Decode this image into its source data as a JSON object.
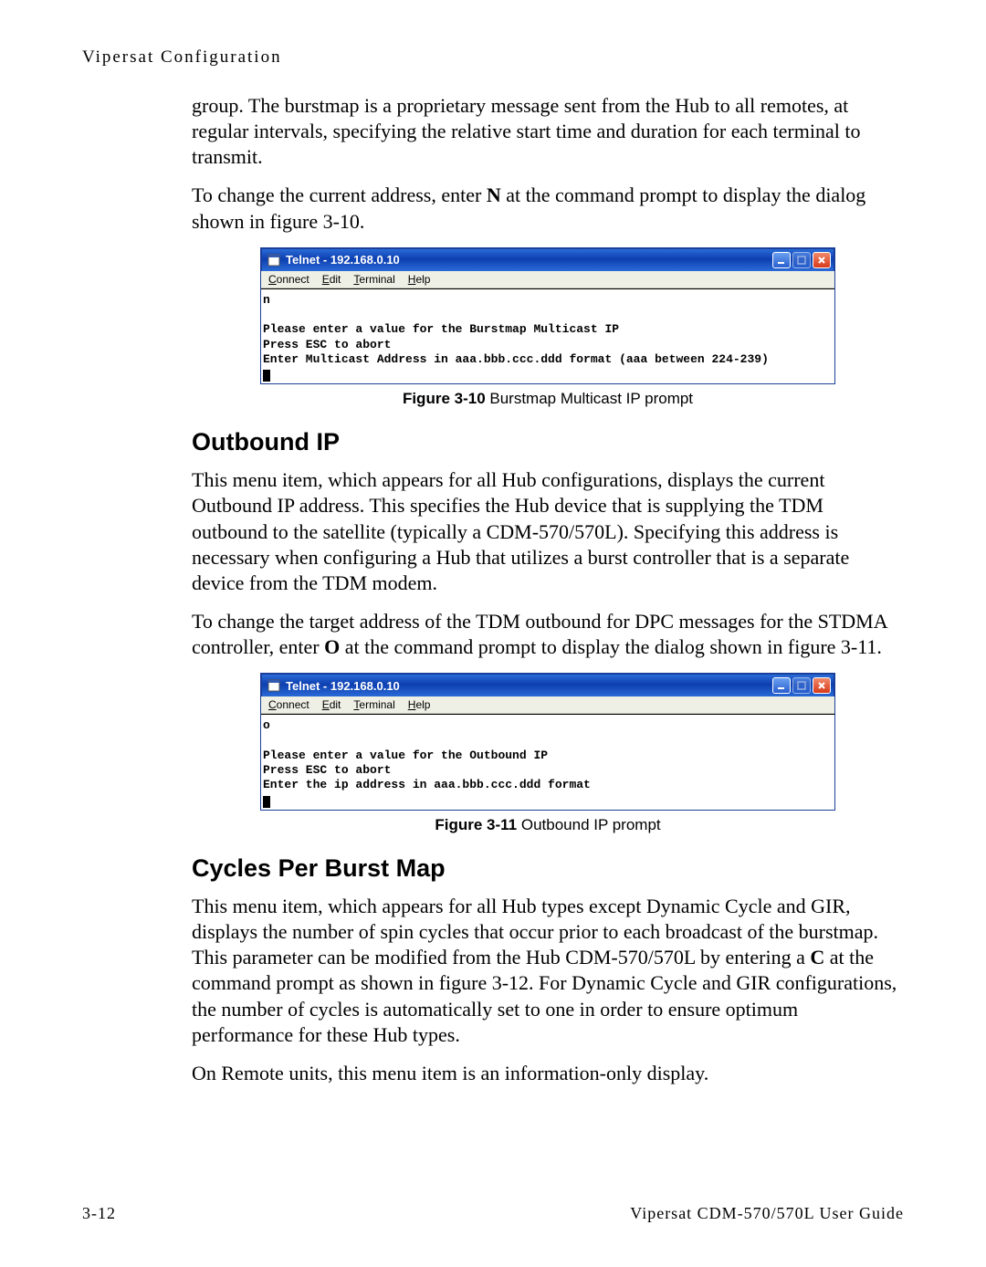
{
  "running_head": "Vipersat Configuration",
  "intro": {
    "p1": "group. The burstmap is a proprietary message sent from the Hub to all remotes, at regular intervals, specifying the relative start time and duration for each terminal to transmit.",
    "p2_a": "To change the current address, enter ",
    "p2_b": "N",
    "p2_c": " at the command prompt to display the dialog shown in figure 3-10."
  },
  "telnet1": {
    "title": "Telnet - 192.168.0.10",
    "menu": {
      "connect_u": "C",
      "connect": "onnect",
      "edit_u": "E",
      "edit": "dit",
      "terminal_u": "T",
      "terminal": "erminal",
      "help_u": "H",
      "help": "elp"
    },
    "lines": {
      "cmd": "n",
      "blank": "",
      "l1": "Please enter a value for the Burstmap Multicast IP",
      "l2": "Press ESC to abort",
      "l3": "Enter Multicast Address in aaa.bbb.ccc.ddd format (aaa between 224-239)"
    }
  },
  "fig1": {
    "label": "Figure 3-10",
    "text": "  Burstmap Multicast IP prompt"
  },
  "outbound": {
    "heading": "Outbound IP",
    "p1": "This menu item, which appears for all Hub configurations, displays the current Outbound IP address. This specifies the Hub device that is supplying the TDM outbound to the satellite (typically a CDM-570/570L). Specifying this address is necessary when configuring a Hub that utilizes a burst controller that is a separate device from the TDM modem.",
    "p2_a": "To change the target address of the TDM outbound for DPC messages for the STDMA controller, enter ",
    "p2_b": "O",
    "p2_c": " at the command prompt to display the dialog shown in figure 3-11."
  },
  "telnet2": {
    "title": "Telnet - 192.168.0.10",
    "menu": {
      "connect_u": "C",
      "connect": "onnect",
      "edit_u": "E",
      "edit": "dit",
      "terminal_u": "T",
      "terminal": "erminal",
      "help_u": "H",
      "help": "elp"
    },
    "lines": {
      "cmd": "o",
      "blank": "",
      "l1": "Please enter a value for the Outbound IP",
      "l2": "Press ESC to abort",
      "l3": "Enter the ip address in aaa.bbb.ccc.ddd format"
    }
  },
  "fig2": {
    "label": "Figure 3-11",
    "text": "  Outbound IP prompt"
  },
  "cycles": {
    "heading": "Cycles Per Burst Map",
    "p1_a": "This menu item, which appears for all Hub types except Dynamic Cycle and GIR, displays the number of spin cycles that occur prior to each broadcast of the burstmap. This parameter can be modified from the Hub CDM-570/570L by entering a ",
    "p1_b": "C",
    "p1_c": " at the command prompt as shown in figure 3-12. For Dynamic Cycle and GIR configurations, the number of cycles is automatically set to one in order to ensure optimum performance for these Hub types.",
    "p2": "On Remote units, this menu item is an information-only display."
  },
  "footer": {
    "left": "3-12",
    "right": "Vipersat CDM-570/570L User Guide"
  }
}
